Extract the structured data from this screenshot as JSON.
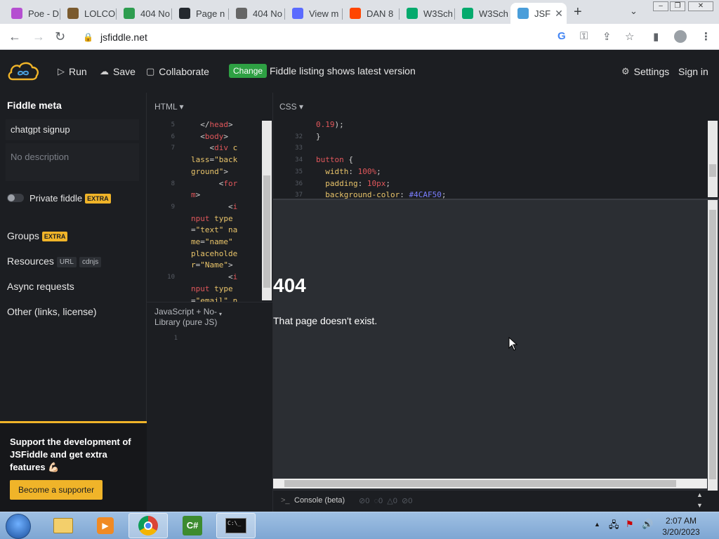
{
  "browser": {
    "tabs": [
      {
        "label": "Poe - D",
        "icon": "poe-icon",
        "color": "#b54fd1"
      },
      {
        "label": "LOLCO",
        "icon": "lolcow-icon",
        "color": "#7a5a2e"
      },
      {
        "label": "404 No",
        "icon": "t-icon",
        "color": "#2e9d4f"
      },
      {
        "label": "Page n",
        "icon": "github-icon",
        "color": "#24292f"
      },
      {
        "label": "404 No",
        "icon": "rocket-icon",
        "color": "#666666"
      },
      {
        "label": "View m",
        "icon": "at-icon",
        "color": "#5b6bff"
      },
      {
        "label": "DAN 8",
        "icon": "reddit-icon",
        "color": "#ff4500"
      },
      {
        "label": "W3Sch",
        "icon": "w3schools-icon",
        "color": "#04aa6d"
      },
      {
        "label": "W3Sch",
        "icon": "w3schools-icon",
        "color": "#04aa6d"
      },
      {
        "label": "JSF",
        "icon": "jsfiddle-icon",
        "color": "#4a9eda"
      }
    ],
    "url": "jsfiddle.net"
  },
  "header": {
    "run_label": "Run",
    "save_label": "Save",
    "collaborate_label": "Collaborate",
    "change_label": "Change",
    "listing_text": "Fiddle listing shows latest version",
    "settings_label": "Settings",
    "signin_label": "Sign in"
  },
  "sidebar": {
    "meta_title": "Fiddle meta",
    "title_value": "chatgpt signup",
    "description_placeholder": "No description",
    "private_label": "Private fiddle",
    "extra_badge": "EXTRA",
    "groups_label": "Groups",
    "resources_label": "Resources",
    "url_tag": "URL",
    "cdnjs_tag": "cdnjs",
    "async_label": "Async requests",
    "other_label": "Other (links, license)",
    "support_text": "Support the development of JSFiddle and get extra features 💪🏻",
    "supporter_button": "Become a supporter"
  },
  "editors": {
    "html_label": "HTML ▾",
    "css_label": "CSS ▾",
    "js_label": "JavaScript + No-Library (pure JS)",
    "js_line": "1",
    "html_lines": [
      {
        "n": "5",
        "parts": [
          [
            "pl",
            "  </"
          ],
          [
            "tg",
            "head"
          ],
          [
            "pl",
            ">"
          ]
        ]
      },
      {
        "n": "6",
        "parts": [
          [
            "pl",
            "  <"
          ],
          [
            "tg",
            "body"
          ],
          [
            "pl",
            ">"
          ]
        ]
      },
      {
        "n": "7",
        "parts": [
          [
            "pl",
            "    <"
          ],
          [
            "tg",
            "div"
          ],
          [
            "at",
            " c"
          ]
        ]
      },
      {
        "n": "",
        "parts": [
          [
            "at",
            "lass"
          ],
          [
            "pl",
            "="
          ],
          [
            "st",
            "\"back"
          ]
        ]
      },
      {
        "n": "",
        "parts": [
          [
            "st",
            "ground\""
          ],
          [
            "pl",
            ">"
          ]
        ]
      },
      {
        "n": "8",
        "parts": [
          [
            "pl",
            "      <"
          ],
          [
            "tg",
            "for"
          ]
        ]
      },
      {
        "n": "",
        "parts": [
          [
            "tg",
            "m"
          ],
          [
            "pl",
            ">"
          ]
        ]
      },
      {
        "n": "9",
        "parts": [
          [
            "pl",
            "        <"
          ],
          [
            "tg",
            "i"
          ]
        ]
      },
      {
        "n": "",
        "parts": [
          [
            "tg",
            "nput"
          ],
          [
            "at",
            " type"
          ]
        ]
      },
      {
        "n": "",
        "parts": [
          [
            "pl",
            "="
          ],
          [
            "st",
            "\"text\""
          ],
          [
            "at",
            " na"
          ]
        ]
      },
      {
        "n": "",
        "parts": [
          [
            "at",
            "me"
          ],
          [
            "pl",
            "="
          ],
          [
            "st",
            "\"name\""
          ]
        ]
      },
      {
        "n": "",
        "parts": [
          [
            "at",
            "placeholde"
          ]
        ]
      },
      {
        "n": "",
        "parts": [
          [
            "at",
            "r"
          ],
          [
            "pl",
            "="
          ],
          [
            "st",
            "\"Name\""
          ],
          [
            "pl",
            ">"
          ]
        ]
      },
      {
        "n": "10",
        "parts": [
          [
            "pl",
            "        <"
          ],
          [
            "tg",
            "i"
          ]
        ]
      },
      {
        "n": "",
        "parts": [
          [
            "tg",
            "nput"
          ],
          [
            "at",
            " type"
          ]
        ]
      },
      {
        "n": "",
        "parts": [
          [
            "pl",
            "="
          ],
          [
            "st",
            "\"email\" n"
          ]
        ]
      }
    ],
    "css_lines": [
      {
        "n": "",
        "parts": [
          [
            "num",
            "0.19"
          ],
          [
            "pl",
            ");"
          ]
        ]
      },
      {
        "n": "32",
        "parts": [
          [
            "pl",
            "}"
          ]
        ]
      },
      {
        "n": "33",
        "parts": [
          [
            "pl",
            ""
          ]
        ]
      },
      {
        "n": "34",
        "parts": [
          [
            "tg",
            "button"
          ],
          [
            "pl",
            " {"
          ]
        ]
      },
      {
        "n": "35",
        "parts": [
          [
            "prop",
            "  width"
          ],
          [
            "pl",
            ": "
          ],
          [
            "num",
            "100%"
          ],
          [
            "pl",
            ";"
          ]
        ]
      },
      {
        "n": "36",
        "parts": [
          [
            "prop",
            "  padding"
          ],
          [
            "pl",
            ": "
          ],
          [
            "num",
            "10px"
          ],
          [
            "pl",
            ";"
          ]
        ]
      },
      {
        "n": "37",
        "parts": [
          [
            "prop",
            "  background-color"
          ],
          [
            "pl",
            ": "
          ],
          [
            "hex",
            "#4CAF50"
          ],
          [
            "pl",
            ";"
          ]
        ]
      }
    ]
  },
  "result": {
    "heading": "404",
    "message": "That page doesn't exist."
  },
  "console": {
    "label": "Console (beta)",
    "counts": [
      "0",
      "0",
      "0",
      "0"
    ]
  },
  "taskbar": {
    "time": "2:07 AM",
    "date": "3/20/2023"
  }
}
